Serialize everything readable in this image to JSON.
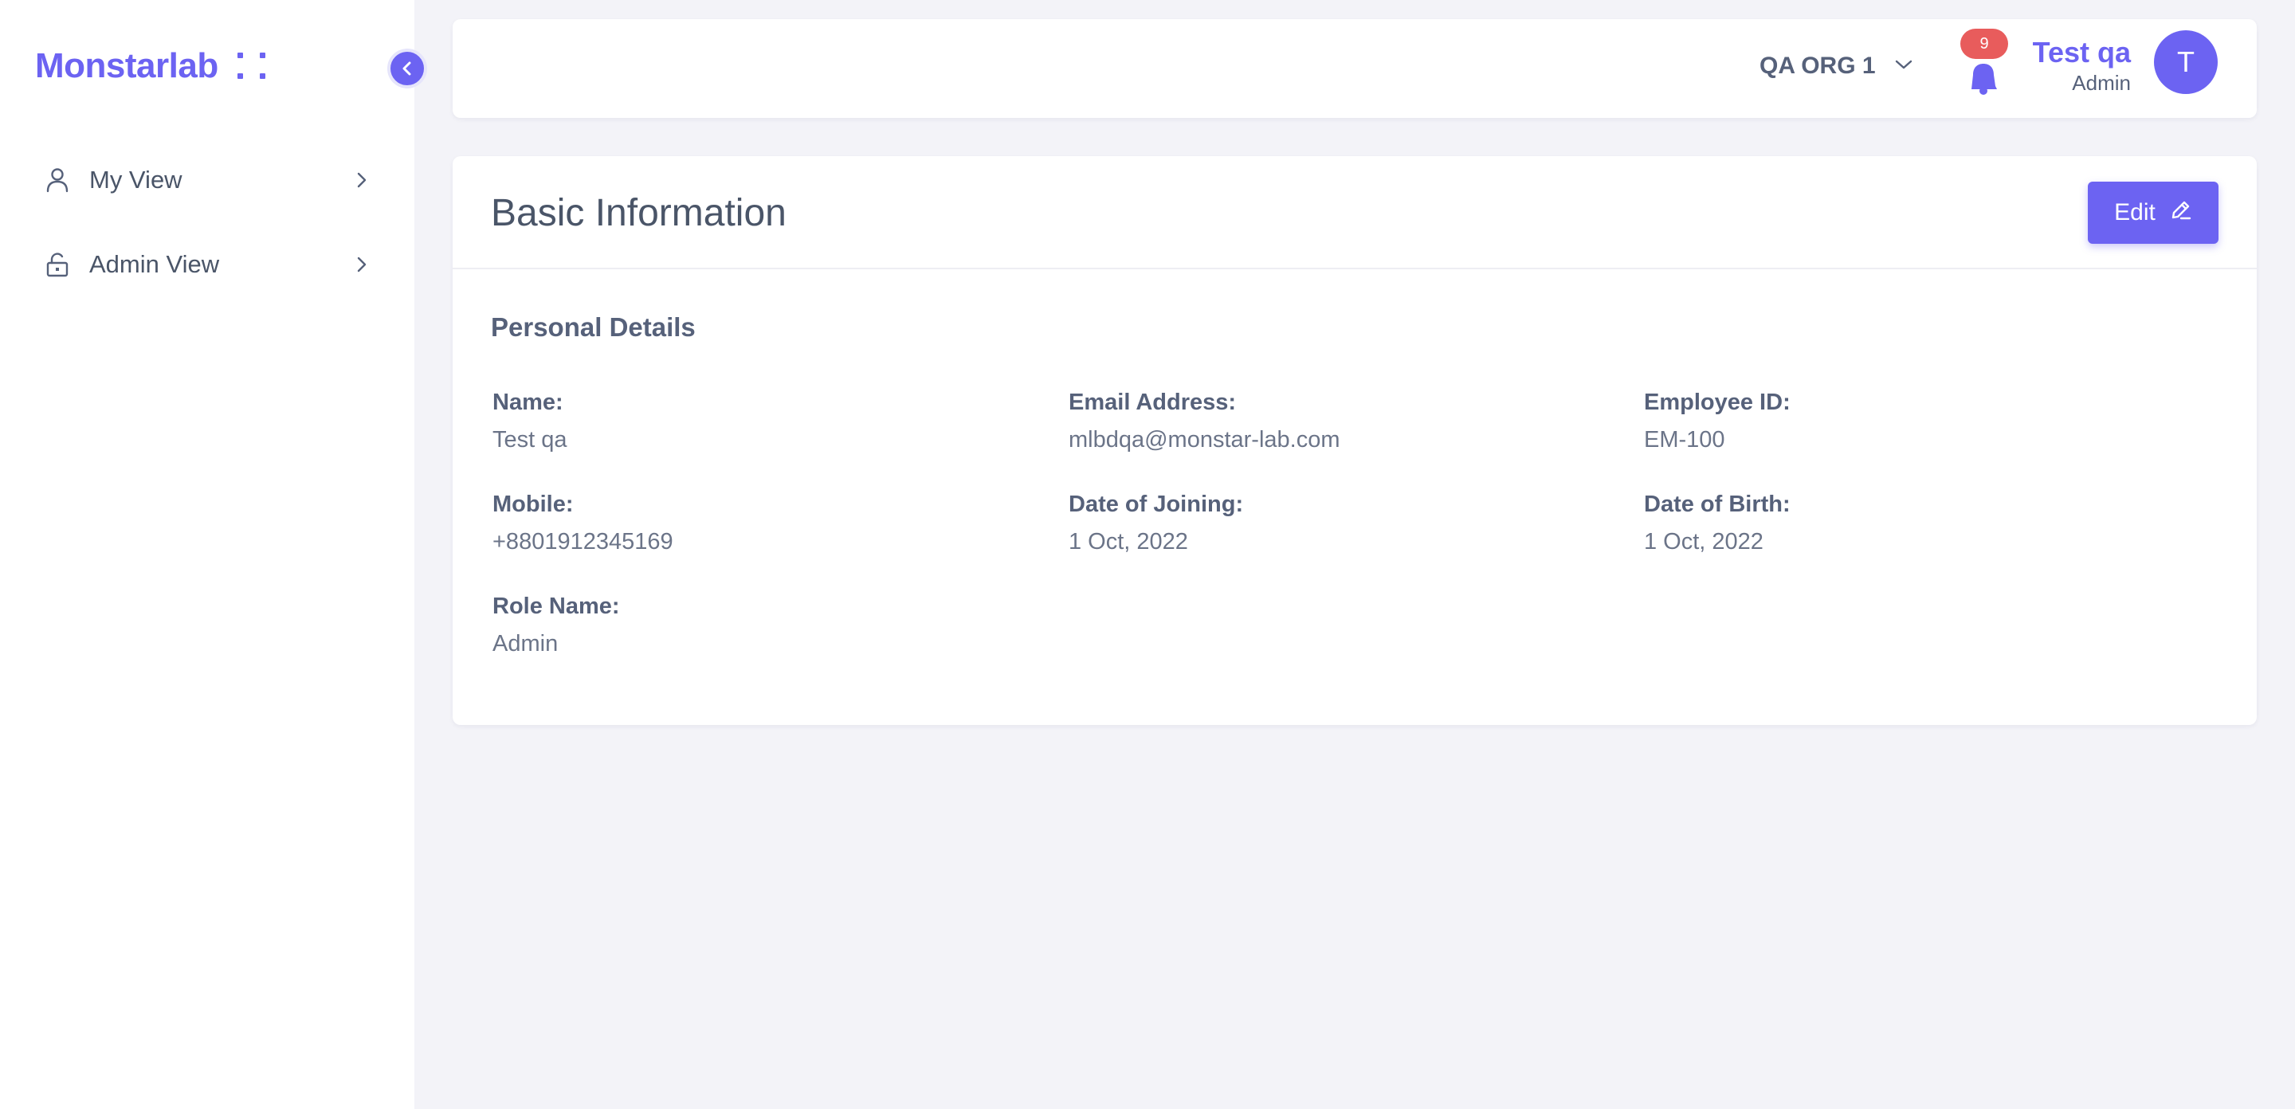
{
  "brand": {
    "name": "Monstarlab",
    "accent_color": "#6c63f2"
  },
  "sidebar": {
    "collapse_icon": "chevron-left-icon",
    "items": [
      {
        "label": "My View",
        "icon": "user-icon"
      },
      {
        "label": "Admin View",
        "icon": "unlock-icon"
      }
    ]
  },
  "header": {
    "org": "QA ORG 1",
    "notifications_count": "9",
    "user_name": "Test qa",
    "user_role": "Admin",
    "avatar_initial": "T"
  },
  "main": {
    "title": "Basic Information",
    "edit_label": "Edit",
    "section_title": "Personal Details",
    "fields": [
      {
        "label": "Name",
        "value": "Test qa"
      },
      {
        "label": "Email Address",
        "value": "mlbdqa@monstar-lab.com"
      },
      {
        "label": "Employee ID",
        "value": "EM-100"
      },
      {
        "label": "Mobile",
        "value": "+8801912345169"
      },
      {
        "label": "Date of Joining",
        "value": "1 Oct, 2022"
      },
      {
        "label": "Date of Birth",
        "value": "1 Oct, 2022"
      },
      {
        "label": "Role Name",
        "value": "Admin"
      }
    ]
  }
}
